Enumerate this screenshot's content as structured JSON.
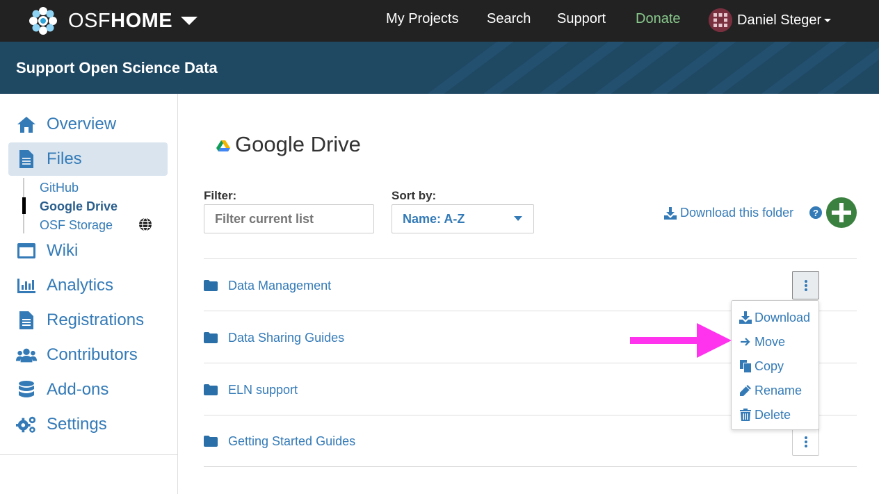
{
  "navbar": {
    "brand_osf": "OSF",
    "brand_home": "HOME",
    "links": [
      "My Projects",
      "Search",
      "Support",
      "Donate"
    ],
    "user_name": "Daniel Steger"
  },
  "banner": {
    "project_title": "Support Open Science Data"
  },
  "sidebar": {
    "items": [
      {
        "label": "Overview",
        "icon": "home-icon"
      },
      {
        "label": "Files",
        "icon": "file-icon",
        "active": true
      },
      {
        "label": "Wiki",
        "icon": "window-icon"
      },
      {
        "label": "Analytics",
        "icon": "bar-chart-icon"
      },
      {
        "label": "Registrations",
        "icon": "file-icon"
      },
      {
        "label": "Contributors",
        "icon": "users-icon"
      },
      {
        "label": "Add-ons",
        "icon": "database-icon"
      },
      {
        "label": "Settings",
        "icon": "gears-icon"
      }
    ],
    "file_providers": [
      {
        "label": "GitHub"
      },
      {
        "label": "Google Drive",
        "active": true
      },
      {
        "label": "OSF Storage",
        "icon": "globe-icon"
      }
    ]
  },
  "main": {
    "title": "Google Drive",
    "filter_label": "Filter:",
    "filter_placeholder": "Filter current list",
    "sort_label": "Sort by:",
    "sort_value": "Name: A-Z",
    "download_folder": "Download this folder",
    "help": "?",
    "folders": [
      "Data Management",
      "Data Sharing Guides",
      "ELN support",
      "Getting Started Guides"
    ]
  },
  "context_menu": {
    "items": [
      "Download",
      "Move",
      "Copy",
      "Rename",
      "Delete"
    ]
  },
  "colors": {
    "navbar": "#222222",
    "banner": "#1f4863",
    "link": "#337ab7",
    "donate": "#89c98c",
    "add_button": "#3a803e",
    "annotation_arrow": "#ff33ee"
  }
}
